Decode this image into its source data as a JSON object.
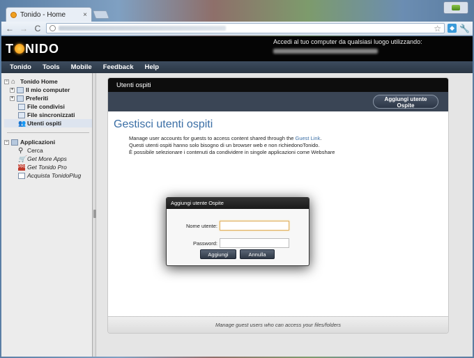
{
  "browser": {
    "tab_title": "Tonido - Home",
    "tab_close": "×",
    "nav_back": "←",
    "nav_forward": "→",
    "nav_reload": "C",
    "star_icon": "☆",
    "wrench_icon": "🔧"
  },
  "app": {
    "logo_left": "T",
    "logo_right": "NIDO",
    "access_text": "Accedi al tuo computer da qualsiasi luogo utilizzando:"
  },
  "menu": [
    "Tonido",
    "Tools",
    "Mobile",
    "Feedback",
    "Help"
  ],
  "sidebar": {
    "home": "Tonido Home",
    "my_computer": "Il mio computer",
    "favorites": "Preferiti",
    "shared_files": "File condivisi",
    "synced_files": "File sincronizzati",
    "guest_users": "Utenti ospiti",
    "apps": "Applicazioni",
    "search": "Cerca",
    "more_apps": "Get More Apps",
    "tonido_pro": "Get Tonido Pro",
    "tonidoplug": "Acquista TonidoPlug",
    "pro_badge": "PRO"
  },
  "panel": {
    "title": "Utenti ospiti",
    "add_button_line1": "Aggiungi utente",
    "add_button_line2": "Ospite",
    "heading": "Gestisci utenti ospiti",
    "desc_line1_pre": "Manage user accounts for guests to access content shared through the ",
    "desc_link": "Guest Link",
    "desc_line1_post": ".",
    "desc_line2": "Questi utenti ospiti hanno solo bisogno di un browser web e non richiedonoTonido.",
    "desc_line3": "È possibile selezionare i contenuti da condividere in singole applicazioni come Webshare",
    "footer": "Manage guest users who can access your files/folders"
  },
  "dialog": {
    "title": "Aggiungi utente Ospite",
    "username_label": "Nome utente:",
    "username_value": "",
    "password_label": "Password:",
    "password_value": "",
    "add_label": "Aggiungi",
    "cancel_label": "Annulla"
  },
  "colors": {
    "accent": "#3a6ea5",
    "banner": "#050505",
    "menubar": "#2f3b4a",
    "dialog_button": "#3a4555"
  }
}
